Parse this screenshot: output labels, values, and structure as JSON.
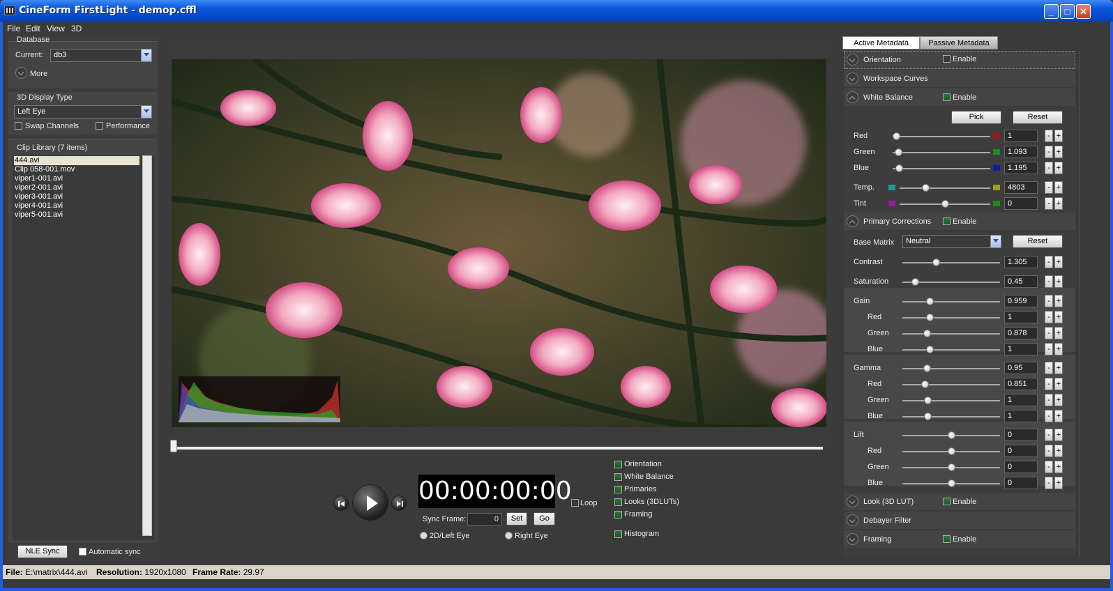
{
  "window": {
    "title": "CineForm FirstLight - demop.cffl"
  },
  "menu": [
    "File",
    "Edit",
    "View",
    "3D"
  ],
  "database": {
    "group": "Database",
    "current_label": "Current:",
    "current_value": "db3",
    "more_label": "More"
  },
  "display": {
    "group": "3D Display Type",
    "value": "Left Eye",
    "swap_label": "Swap Channels",
    "performance_label": "Performance"
  },
  "clips": {
    "group": "Clip Library (7 items)",
    "items": [
      "444.avi",
      "Clip 058-001.mov",
      "viper1-001.avi",
      "viper2-001.avi",
      "viper3-001.avi",
      "viper4-001.avi",
      "viper5-001.avi"
    ],
    "selected": 0
  },
  "left_bottom": {
    "nle_label": "NLE Sync",
    "auto_label": "Automatic sync"
  },
  "transport": {
    "timecode": "00:00:00:00",
    "loop_label": "Loop",
    "sync_label": "Sync Frame:",
    "sync_value": "0",
    "set_label": "Set",
    "go_label": "Go",
    "left_eye_label": "2D/Left Eye",
    "right_eye_label": "Right Eye",
    "toggles": [
      "Orientation",
      "White  Balance",
      "Primaries",
      "Looks (3DLUTs)",
      "Framing",
      "Histogram"
    ]
  },
  "tabs": {
    "active": "Active Metadata",
    "passive": "Passive Metadata"
  },
  "panel": {
    "enable_label": "Enable",
    "orientation": "Orientation",
    "workspace": "Workspace Curves",
    "white_balance": "White Balance",
    "pick_label": "Pick",
    "reset_label": "Reset",
    "wb_rows": [
      {
        "label": "Red",
        "value": "1"
      },
      {
        "label": "Green",
        "value": "1.093"
      },
      {
        "label": "Blue",
        "value": "1.195"
      },
      {
        "label": "Temp.",
        "value": "4803"
      },
      {
        "label": "Tint",
        "value": "0"
      }
    ],
    "primary": "Primary Corrections",
    "base_matrix_label": "Base Matrix",
    "base_matrix_value": "Neutral",
    "pc_rows": [
      {
        "label": "Contrast",
        "value": "1.305"
      },
      {
        "label": "Saturation",
        "value": "0.45"
      },
      {
        "label": "Gain",
        "value": "0.959"
      },
      {
        "label": "Red",
        "value": "1"
      },
      {
        "label": "Green",
        "value": "0.878"
      },
      {
        "label": "Blue",
        "value": "1"
      },
      {
        "label": "Gamma",
        "value": "0.95"
      },
      {
        "label": "Red",
        "value": "0.851"
      },
      {
        "label": "Green",
        "value": "1"
      },
      {
        "label": "Blue",
        "value": "1"
      },
      {
        "label": "Lift",
        "value": "0"
      },
      {
        "label": "Red",
        "value": "0"
      },
      {
        "label": "Green",
        "value": "0"
      },
      {
        "label": "Blue",
        "value": "0"
      }
    ],
    "look": "Look (3D LUT)",
    "debayer": "Debayer Filter",
    "framing": "Framing",
    "minus": "-",
    "plus": "+"
  },
  "status": {
    "file_label": "File:",
    "file": "E:\\matrix\\444.avi",
    "res_label": "Resolution:",
    "res": "1920x1080",
    "fps_label": "Frame Rate:",
    "fps": "29.97"
  },
  "colors": {
    "accent": "#0a55d8",
    "panel": "#3a3a3a",
    "check_on": "#2a7a32"
  }
}
